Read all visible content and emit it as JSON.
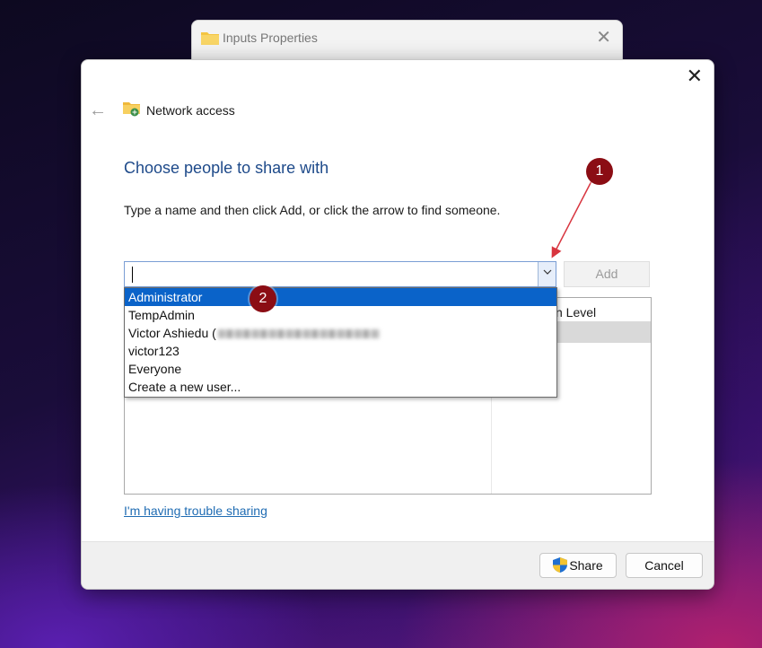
{
  "background_window": {
    "title": "Inputs Properties",
    "close_glyph": "✕"
  },
  "dialog": {
    "close_glyph": "✕",
    "back_glyph": "←",
    "header_title": "Network access",
    "heading": "Choose people to share with",
    "instruction": "Type a name and then click Add, or click the arrow to find someone.",
    "input_value": "",
    "dropdown_glyph": "⌵",
    "add_label": "Add",
    "column_header_partial": "n Level",
    "dropdown_options": [
      "Administrator",
      "TempAdmin",
      "Victor Ashiedu (",
      "victor123",
      "Everyone",
      "Create a new user..."
    ],
    "highlighted_option": "Administrator",
    "trouble_link": "I'm having trouble sharing",
    "share_label": "Share",
    "cancel_label": "Cancel"
  },
  "annotations": {
    "badge_1": "1",
    "badge_2": "2",
    "color": "#8b0d14"
  },
  "icons": [
    "folder-icon",
    "network-folder-icon",
    "back-arrow-icon",
    "close-icon",
    "chevron-down-icon",
    "uac-shield-icon"
  ]
}
